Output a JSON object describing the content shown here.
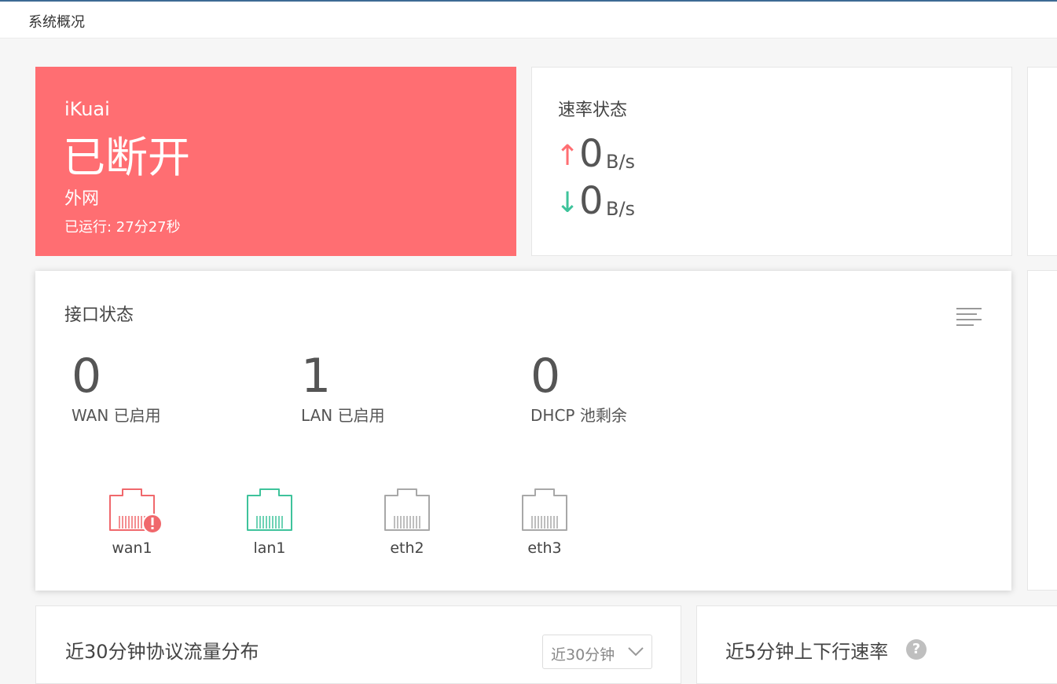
{
  "header": {
    "title": "系统概况"
  },
  "wan_card": {
    "brand": "iKuai",
    "state": "已断开",
    "network": "外网",
    "uptime": "已运行: 27分27秒",
    "color": "#ff6e72"
  },
  "rate": {
    "title": "速率状态",
    "upload": {
      "value": "0",
      "unit": "B/s",
      "icon": "arrow-up-icon"
    },
    "download": {
      "value": "0",
      "unit": "B/s",
      "icon": "arrow-down-icon"
    }
  },
  "interfaces": {
    "title": "接口状态",
    "stats": [
      {
        "value": "0",
        "label": "WAN 已启用"
      },
      {
        "value": "1",
        "label": "LAN 已启用"
      },
      {
        "value": "0",
        "label": "DHCP 池剩余"
      }
    ],
    "ports": [
      {
        "name": "wan1",
        "status": "error",
        "color": "#f0686c"
      },
      {
        "name": "lan1",
        "status": "up",
        "color": "#3ec39b"
      },
      {
        "name": "eth2",
        "status": "idle",
        "color": "#a8a8a8"
      },
      {
        "name": "eth3",
        "status": "idle",
        "color": "#a8a8a8"
      }
    ]
  },
  "protocol": {
    "title": "近30分钟协议流量分布",
    "range_select": "近30分钟"
  },
  "speed": {
    "title": "近5分钟上下行速率",
    "help": "?"
  }
}
